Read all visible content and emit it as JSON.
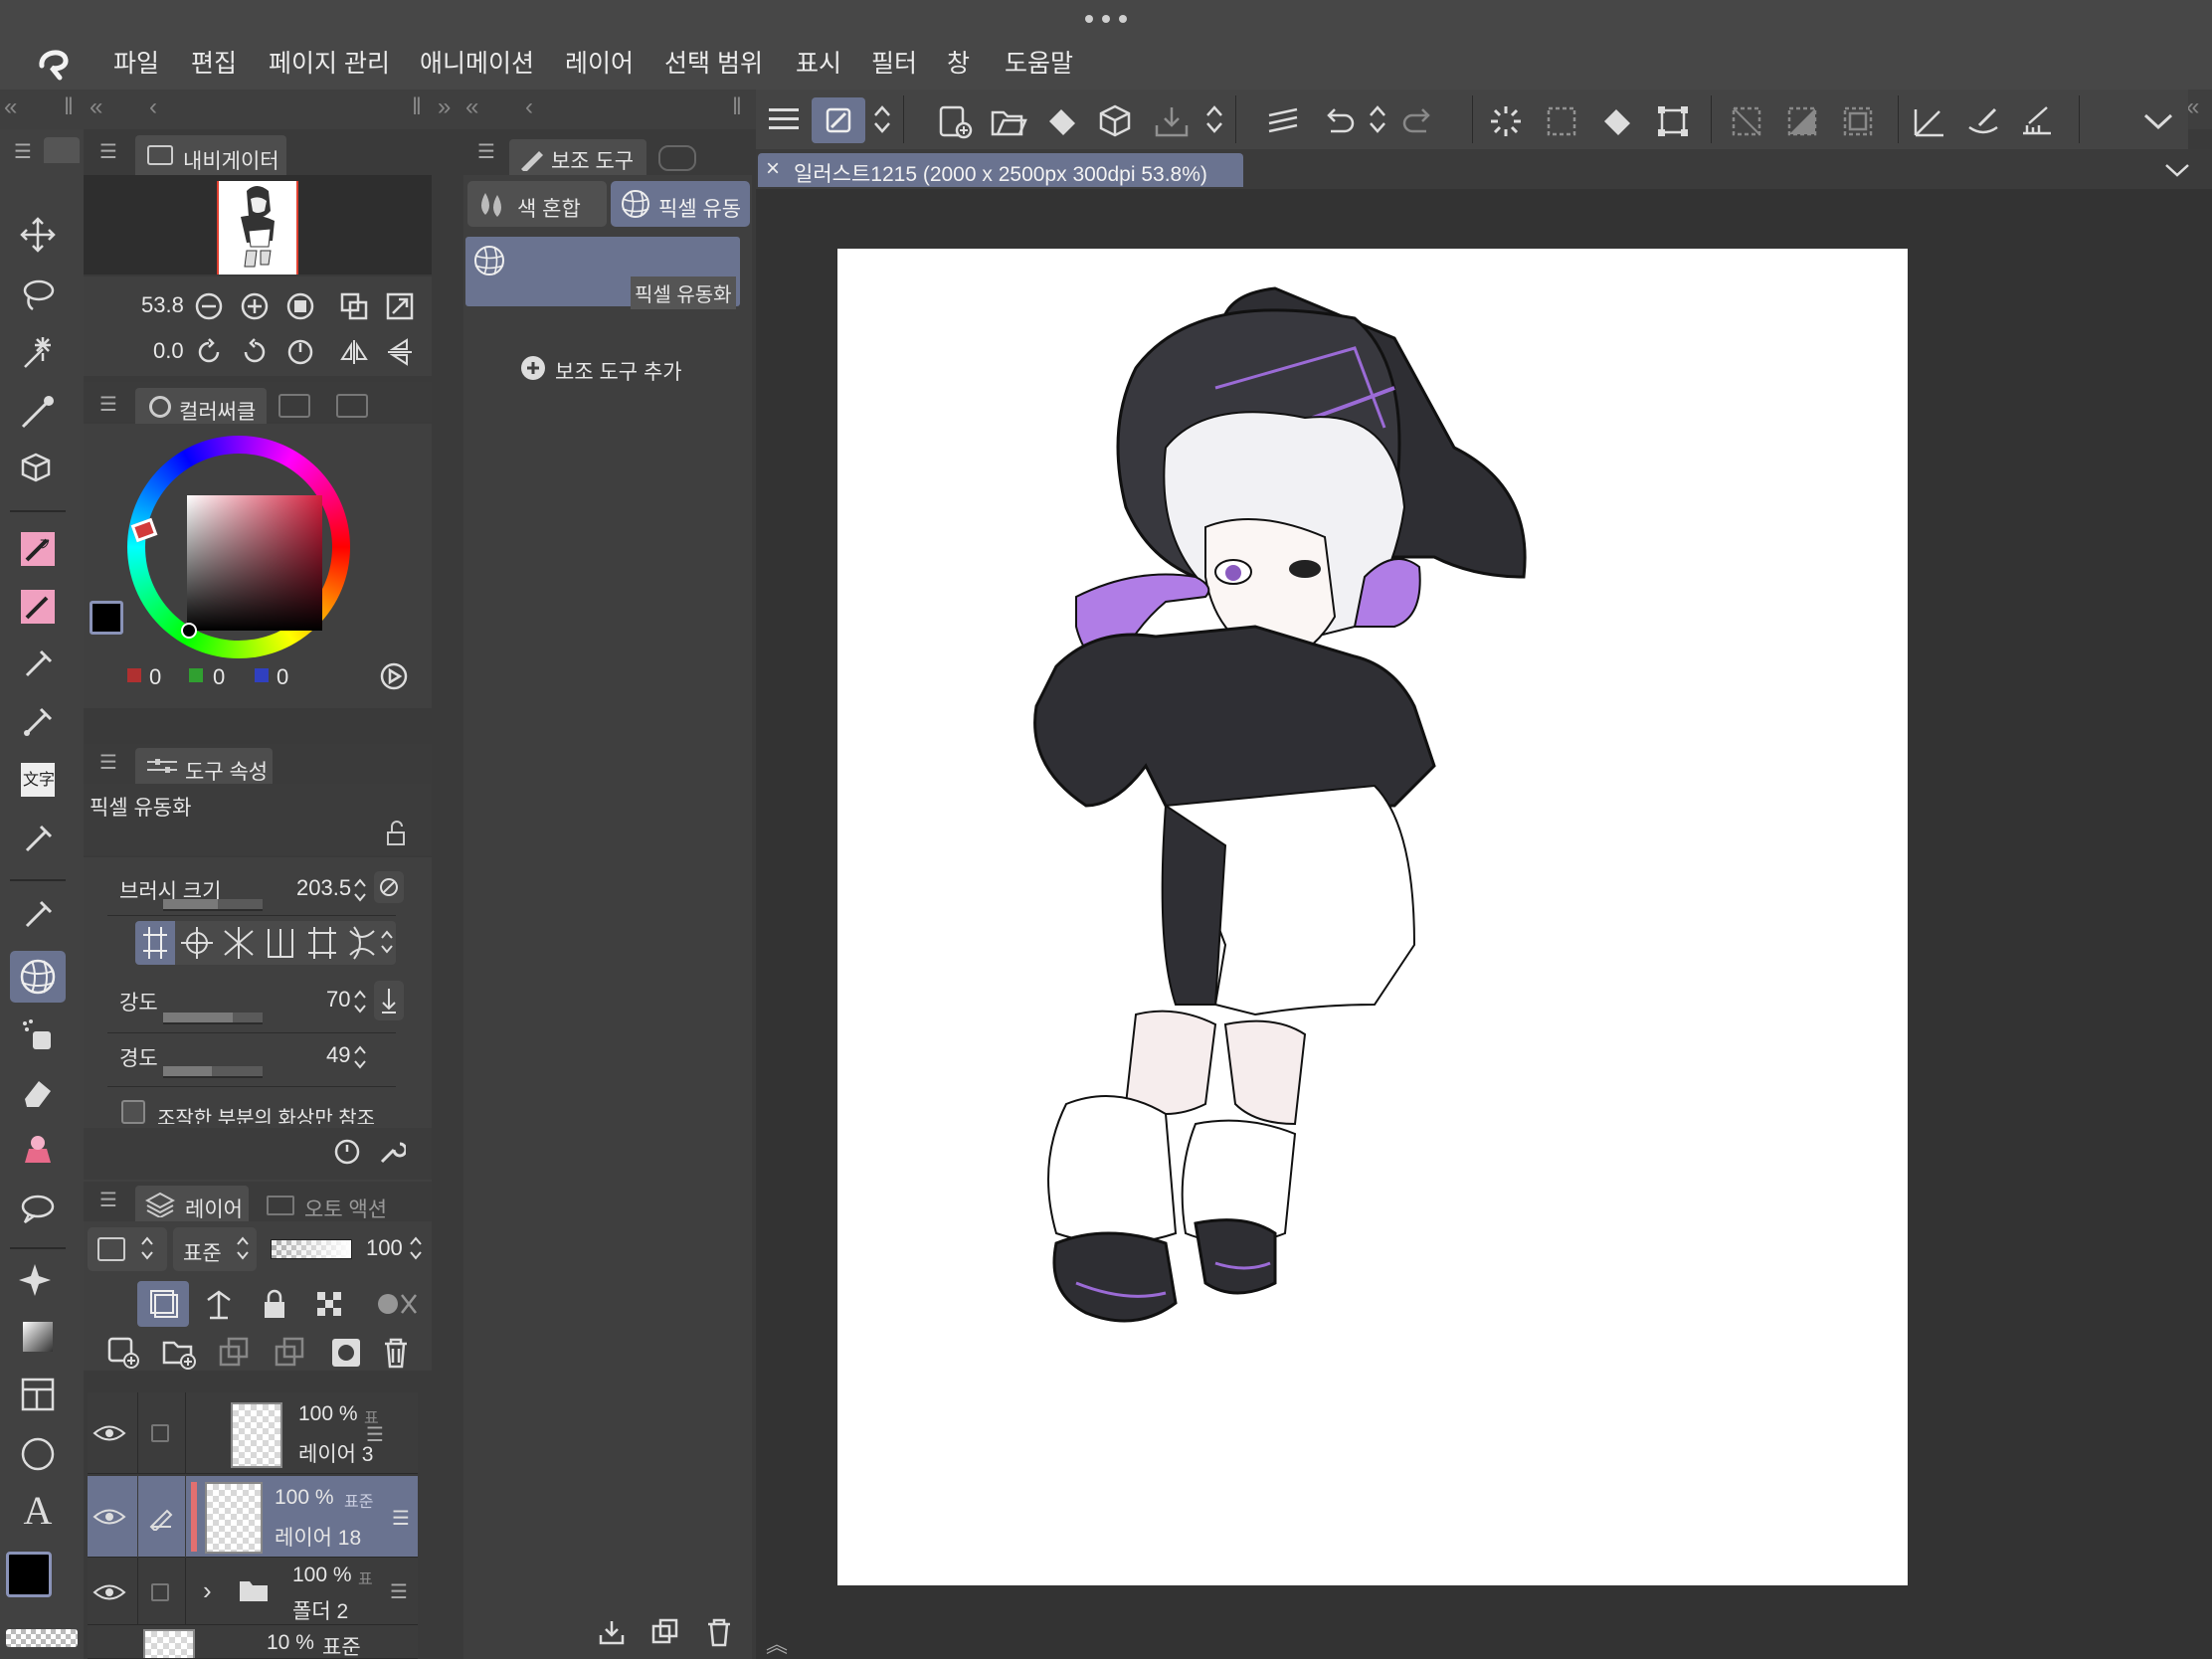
{
  "menu": {
    "items": [
      "파일",
      "편집",
      "페이지 관리",
      "애니메이션",
      "레이어",
      "선택 범위",
      "표시",
      "필터",
      "창",
      "도움말"
    ]
  },
  "navigator": {
    "tab_label": "내비게이터",
    "zoom_value": "53.8",
    "rotation_value": "0.0"
  },
  "color": {
    "tab_label": "컬러써클",
    "r": "0",
    "g": "0",
    "b": "0",
    "hue_marker_color": "#d23a3a",
    "main_color": "#000000",
    "sub_color": "#000000"
  },
  "tool_property": {
    "tab_label": "도구 속성",
    "tool_name": "픽셀 유동화",
    "brush_size_label": "브러시 크기",
    "brush_size_value": "203.5",
    "strength_label": "강도",
    "strength_value": "70",
    "strength_level_percent": 70,
    "hardness_label": "경도",
    "hardness_value": "49",
    "hardness_level_percent": 49,
    "brush_size_level_percent": 55,
    "reference_checkbox_label": "조작한 부분의 화상만 참조"
  },
  "layer": {
    "tab_label": "레이어",
    "tab2_label": "오토 액션",
    "blend_mode": "표준",
    "opacity": "100",
    "rows": [
      {
        "opacity": "100 %",
        "mode": "표",
        "name": "레이어 3"
      },
      {
        "opacity": "100 %",
        "mode": "표준",
        "name": "레이어 18"
      },
      {
        "opacity": "100 %",
        "mode": "표",
        "name": "폴더 2"
      },
      {
        "opacity": "10 %",
        "mode": "표준",
        "name": ""
      }
    ]
  },
  "subtool": {
    "tab_label": "보조 도구",
    "group_tab1": "색 혼합",
    "group_tab2": "픽셀 유동",
    "item_label": "픽셀 유동화",
    "add_label": "보조 도구 추가"
  },
  "canvas": {
    "tab_title": "일러스트1215 (2000 x 2500px 300dpi 53.8%)"
  },
  "colors": {
    "accent": "#6a7390",
    "panel_bg": "#3a3a3a",
    "canvas_bg": "#ffffff"
  }
}
